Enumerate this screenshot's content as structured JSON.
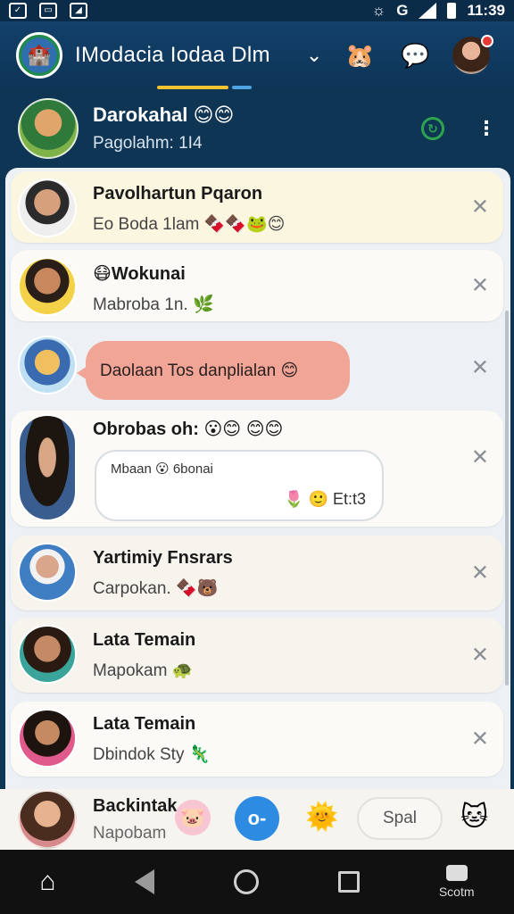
{
  "status_bar": {
    "time": "11:39",
    "carrier_glyph": "G"
  },
  "header": {
    "title": "IModacia Iodaa Dlm",
    "icons": [
      "hamster-icon",
      "chat-bubble-icon"
    ]
  },
  "pinned_chat": {
    "name": "Darokahal 😊😊",
    "subtitle": "Pagolahm: 1I4"
  },
  "chats": [
    {
      "name": "Pavolhartun Pqaron",
      "preview": "Eo Boda 1lam 🍫🍫🐸😊"
    },
    {
      "name": "😷Wokunai",
      "preview": "Mabroba 1n. 🌿"
    },
    {
      "name": "",
      "preview": "Daolaan Tos danplialan 😊"
    },
    {
      "name": "Obrobas oh: 😮😊 😊😊",
      "bubble_line1": "Mbaan 😮 6bonai",
      "bubble_line2": "🌷 🙂 Et:t3"
    },
    {
      "name": "Yartimiy Fnsrars",
      "preview": "Carpokan. 🍫🐻"
    },
    {
      "name": "Lata Temain",
      "preview": "Mapokam 🐢"
    },
    {
      "name": "Lata Temain",
      "preview": "Dbindok Sty 🦎"
    }
  ],
  "composer": {
    "name": "Backintak",
    "subtitle": "Napobam",
    "send_label": "o-",
    "chip_label": "Spal"
  },
  "navbar": {
    "score_label": "Scotm"
  },
  "colors": {
    "header_bg": "#12406a",
    "accent_blue": "#2d8be2",
    "pink_bubble": "#f1a596",
    "green": "#2ea44f"
  }
}
